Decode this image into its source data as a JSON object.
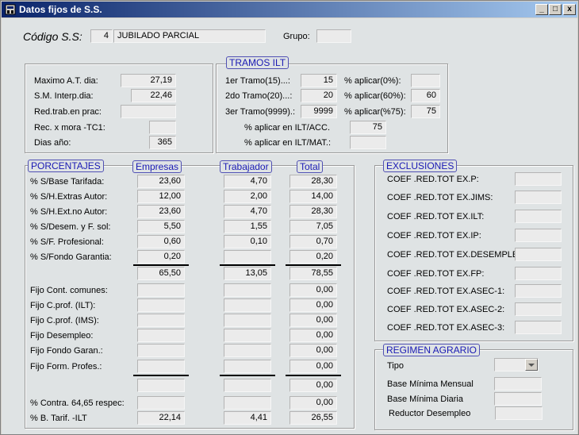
{
  "window": {
    "title": "Datos fijos de S.S.",
    "min": "_",
    "max": "□",
    "close": "x"
  },
  "header": {
    "codigo_label": "Código S.S:",
    "codigo_num": "4",
    "codigo_desc": "JUBILADO PARCIAL",
    "grupo_label": "Grupo:",
    "grupo_value": ""
  },
  "left_top": {
    "rows": [
      {
        "label": "Maximo A.T. dia:",
        "value": "27,19"
      },
      {
        "label": "S.M. Interp.dia:",
        "value": "22,46"
      },
      {
        "label": "Red.trab.en prac:",
        "value": ""
      },
      {
        "label": "Rec. x mora -TC1:",
        "value": ""
      },
      {
        "label": "Dias año:",
        "value": "365"
      }
    ]
  },
  "tramos": {
    "title": "TRAMOS ILT",
    "rows": [
      {
        "label": "1er Tramo(15)...:",
        "value": "15",
        "pct_label": "% aplicar(0%):",
        "pct_value": ""
      },
      {
        "label": "2do Tramo(20)...:",
        "value": "20",
        "pct_label": "% aplicar(60%):",
        "pct_value": "60"
      },
      {
        "label": "3er Tramo(9999).:",
        "value": "9999",
        "pct_label": "% aplicar(%75):",
        "pct_value": "75"
      }
    ],
    "acc_label": "% aplicar en ILT/ACC.",
    "acc_value": "75",
    "mat_label": "% aplicar en ILT/MAT.:",
    "mat_value": ""
  },
  "porcentajes": {
    "title": "PORCENTAJES",
    "col_empresas": "Empresas",
    "col_trabajador": "Trabajador",
    "col_total": "Total",
    "rows": [
      {
        "label": "% S/Base Tarifada:",
        "emp": "23,60",
        "trab": "4,70",
        "total": "28,30"
      },
      {
        "label": "% S/H.Extras Autor:",
        "emp": "12,00",
        "trab": "2,00",
        "total": "14,00"
      },
      {
        "label": "% S/H.Ext.no Autor:",
        "emp": "23,60",
        "trab": "4,70",
        "total": "28,30"
      },
      {
        "label": "% S/Desem. y F. sol:",
        "emp": "5,50",
        "trab": "1,55",
        "total": "7,05"
      },
      {
        "label": "% S/F. Profesional:",
        "emp": "0,60",
        "trab": "0,10",
        "total": "0,70"
      },
      {
        "label": "% S/Fondo Garantia:",
        "emp": "0,20",
        "trab": "",
        "total": "0,20"
      }
    ],
    "subtotal": {
      "emp": "65,50",
      "trab": "13,05",
      "total": "78,55"
    },
    "fijo_rows": [
      {
        "label": "Fijo Cont. comunes:",
        "emp": "",
        "trab": "",
        "total": "0,00"
      },
      {
        "label": "Fijo   C.prof. (ILT):",
        "emp": "",
        "trab": "",
        "total": "0,00"
      },
      {
        "label": "Fijo   C.prof. (IMS):",
        "emp": "",
        "trab": "",
        "total": "0,00"
      },
      {
        "label": "Fijo  Desempleo:",
        "emp": "",
        "trab": "",
        "total": "0,00"
      },
      {
        "label": "Fijo  Fondo Garan.:",
        "emp": "",
        "trab": "",
        "total": "0,00"
      },
      {
        "label": "Fijo Form. Profes.:",
        "emp": "",
        "trab": "",
        "total": "0,00"
      }
    ],
    "fijo_total": {
      "emp": "",
      "trab": "",
      "total": "0,00"
    },
    "contra": {
      "label": "% Contra. 64,65 respec:",
      "emp": "",
      "trab": "",
      "total": "0,00"
    },
    "btarif": {
      "label": "% B. Tarif. -ILT",
      "emp": "22,14",
      "trab": "4,41",
      "total": "26,55"
    }
  },
  "exclusiones": {
    "title": "EXCLUSIONES",
    "rows": [
      {
        "label": "COEF .RED.TOT EX.P:",
        "value": ""
      },
      {
        "label": "COEF .RED.TOT EX.JIMS:",
        "value": ""
      },
      {
        "label": "COEF .RED.TOT EX.ILT:",
        "value": ""
      },
      {
        "label": "COEF .RED.TOT EX.IP:",
        "value": ""
      },
      {
        "label": "COEF .RED.TOT EX.DESEMPLEO:",
        "value": ""
      },
      {
        "label": "COEF .RED.TOT EX.FP:",
        "value": ""
      },
      {
        "label": "COEF .RED.TOT EX.ASEC-1:",
        "value": ""
      },
      {
        "label": "COEF .RED.TOT EX.ASEC-2:",
        "value": ""
      },
      {
        "label": "COEF .RED.TOT EX.ASEC-3:",
        "value": ""
      }
    ]
  },
  "agrario": {
    "title": "REGIMEN AGRARIO",
    "tipo_label": "Tipo",
    "tipo_value": "",
    "mensual_label": "Base Mínima Mensual",
    "mensual_value": "",
    "diaria_label": "Base Mínima Diaria",
    "diaria_value": "",
    "reductor_label": "Reductor Desempleo",
    "reductor_value": ""
  }
}
